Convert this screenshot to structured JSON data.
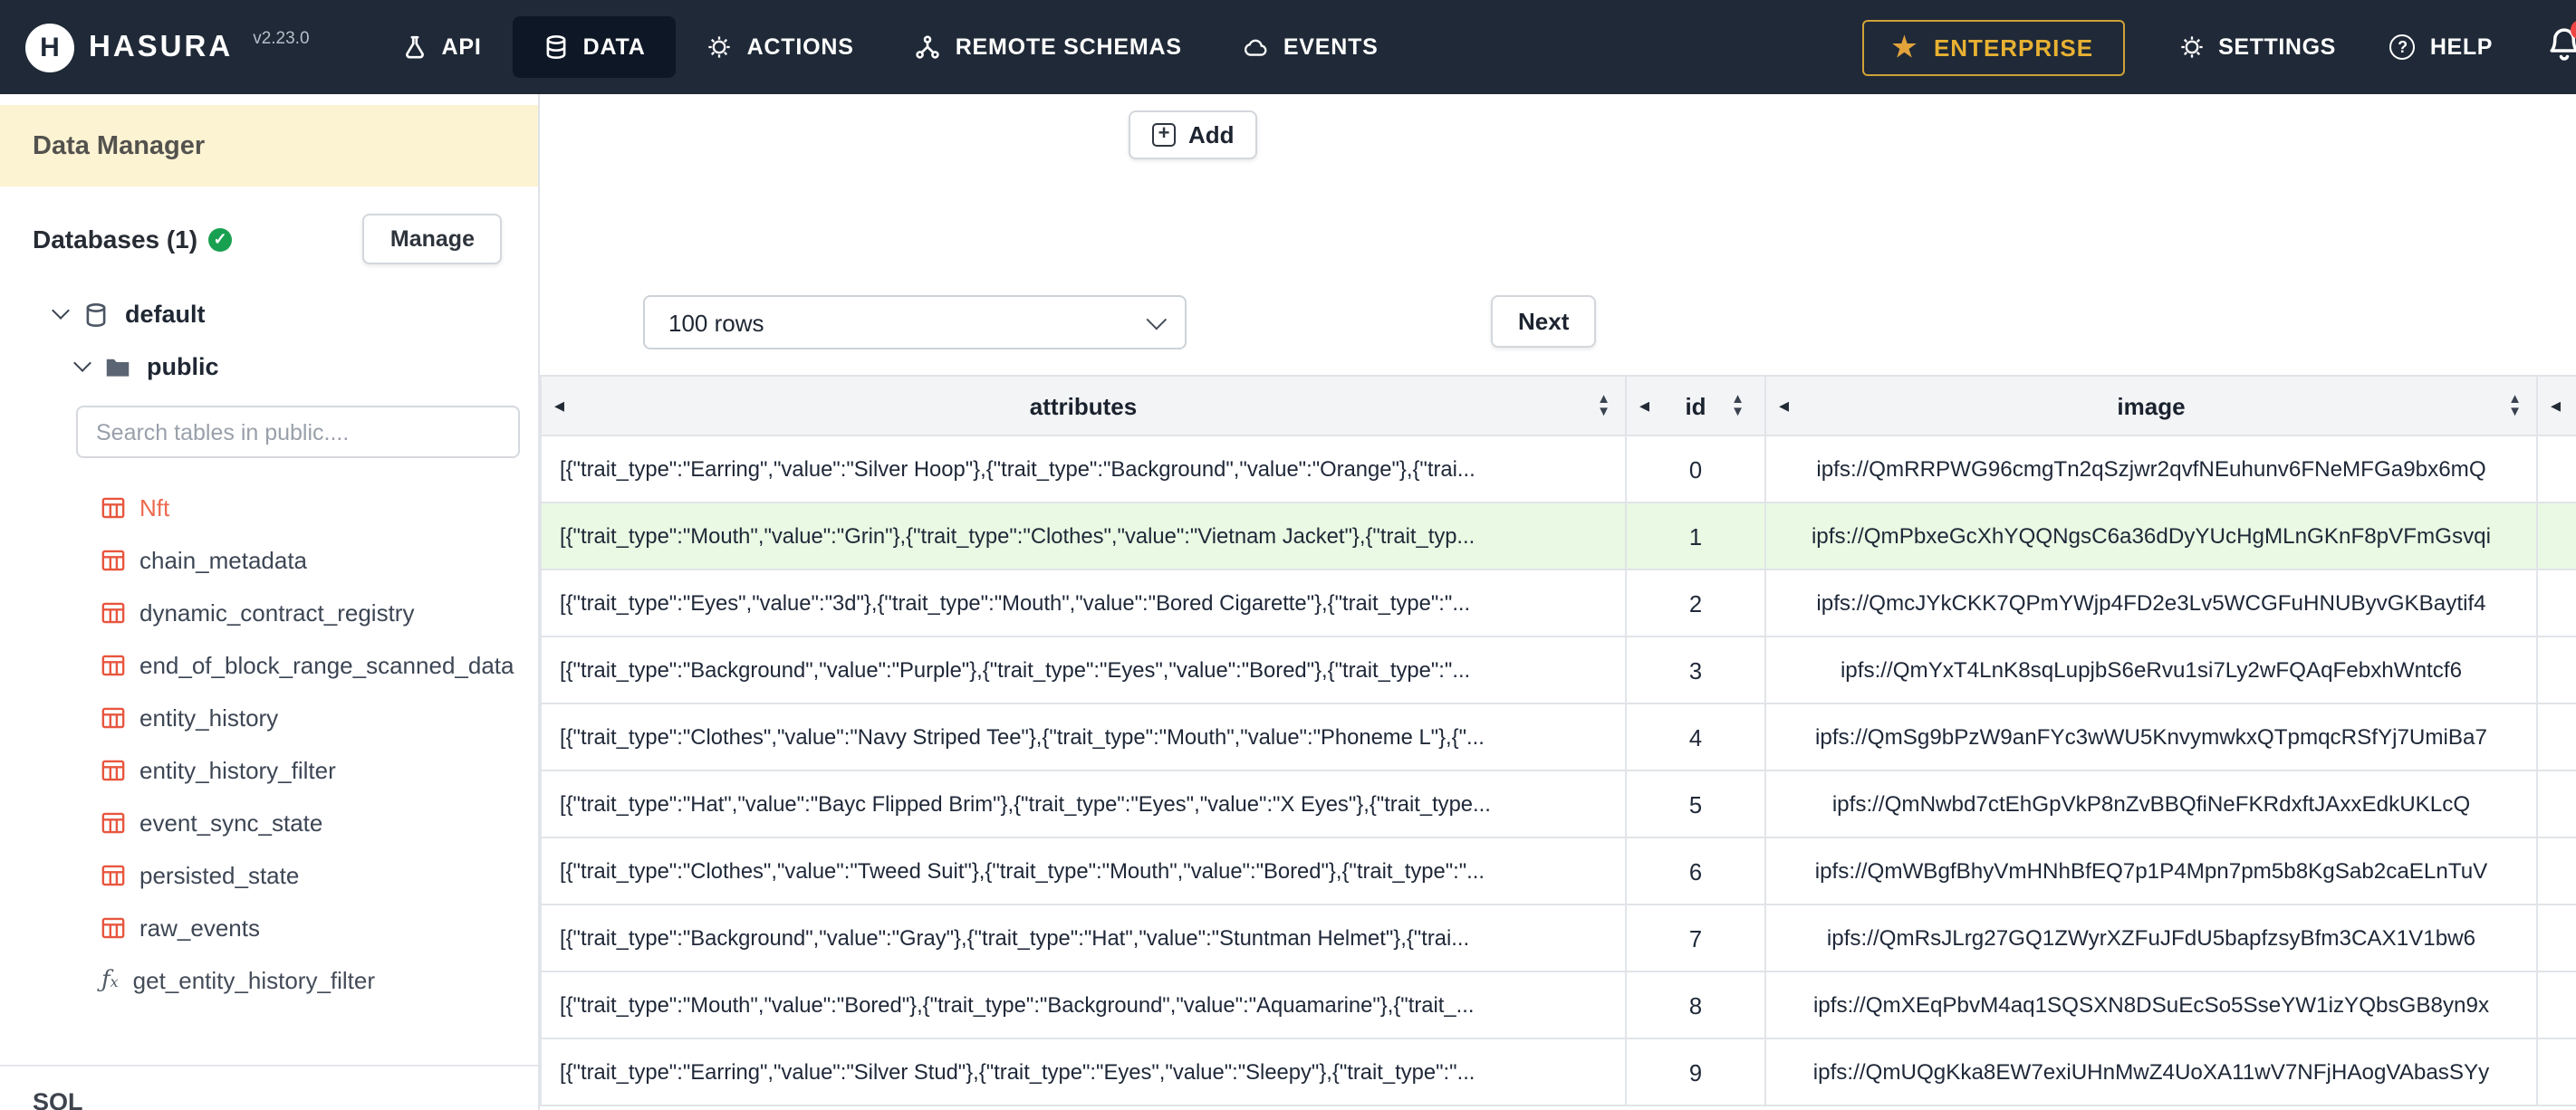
{
  "navbar": {
    "brand": "HASURA",
    "version": "v2.23.0",
    "items": [
      {
        "label": "API"
      },
      {
        "label": "DATA"
      },
      {
        "label": "ACTIONS"
      },
      {
        "label": "REMOTE SCHEMAS"
      },
      {
        "label": "EVENTS"
      }
    ],
    "enterprise": "ENTERPRISE",
    "settings": "SETTINGS",
    "help": "HELP"
  },
  "sidebar": {
    "title": "Data Manager",
    "databases_label": "Databases (1)",
    "manage": "Manage",
    "database": "default",
    "schema": "public",
    "search_placeholder": "Search tables in public....",
    "tables": [
      "Nft",
      "chain_metadata",
      "dynamic_contract_registry",
      "end_of_block_range_scanned_data",
      "entity_history",
      "entity_history_filter",
      "event_sync_state",
      "persisted_state",
      "raw_events"
    ],
    "function": "get_entity_history_filter",
    "sql_label": "SQL"
  },
  "main": {
    "add": "Add",
    "rows_select": "100 rows",
    "next": "Next",
    "table": {
      "columns": [
        "attributes",
        "id",
        "image"
      ],
      "rows": [
        {
          "attributes": "[{\"trait_type\":\"Earring\",\"value\":\"Silver Hoop\"},{\"trait_type\":\"Background\",\"value\":\"Orange\"},{\"trai...",
          "id": 0,
          "image": "ipfs://QmRRPWG96cmgTn2qSzjwr2qvfNEuhunv6FNeMFGa9bx6mQ"
        },
        {
          "attributes": "[{\"trait_type\":\"Mouth\",\"value\":\"Grin\"},{\"trait_type\":\"Clothes\",\"value\":\"Vietnam Jacket\"},{\"trait_typ...",
          "id": 1,
          "image": "ipfs://QmPbxeGcXhYQQNgsC6a36dDyYUcHgMLnGKnF8pVFmGsvqi"
        },
        {
          "attributes": "[{\"trait_type\":\"Eyes\",\"value\":\"3d\"},{\"trait_type\":\"Mouth\",\"value\":\"Bored Cigarette\"},{\"trait_type\":\"...",
          "id": 2,
          "image": "ipfs://QmcJYkCKK7QPmYWjp4FD2e3Lv5WCGFuHNUByvGKBaytif4"
        },
        {
          "attributes": "[{\"trait_type\":\"Background\",\"value\":\"Purple\"},{\"trait_type\":\"Eyes\",\"value\":\"Bored\"},{\"trait_type\":\"...",
          "id": 3,
          "image": "ipfs://QmYxT4LnK8sqLupjbS6eRvu1si7Ly2wFQAqFebxhWntcf6"
        },
        {
          "attributes": "[{\"trait_type\":\"Clothes\",\"value\":\"Navy Striped Tee\"},{\"trait_type\":\"Mouth\",\"value\":\"Phoneme L\"},{\"...",
          "id": 4,
          "image": "ipfs://QmSg9bPzW9anFYc3wWU5KnvymwkxQTpmqcRSfYj7UmiBa7"
        },
        {
          "attributes": "[{\"trait_type\":\"Hat\",\"value\":\"Bayc Flipped Brim\"},{\"trait_type\":\"Eyes\",\"value\":\"X Eyes\"},{\"trait_type...",
          "id": 5,
          "image": "ipfs://QmNwbd7ctEhGpVkP8nZvBBQfiNeFKRdxftJAxxEdkUKLcQ"
        },
        {
          "attributes": "[{\"trait_type\":\"Clothes\",\"value\":\"Tweed Suit\"},{\"trait_type\":\"Mouth\",\"value\":\"Bored\"},{\"trait_type\":\"...",
          "id": 6,
          "image": "ipfs://QmWBgfBhyVmHNhBfEQ7p1P4Mpn7pm5b8KgSab2caELnTuV"
        },
        {
          "attributes": "[{\"trait_type\":\"Background\",\"value\":\"Gray\"},{\"trait_type\":\"Hat\",\"value\":\"Stuntman Helmet\"},{\"trai...",
          "id": 7,
          "image": "ipfs://QmRsJLrg27GQ1ZWyrXZFuJFdU5bapfzsyBfm3CAX1V1bw6"
        },
        {
          "attributes": "[{\"trait_type\":\"Mouth\",\"value\":\"Bored\"},{\"trait_type\":\"Background\",\"value\":\"Aquamarine\"},{\"trait_...",
          "id": 8,
          "image": "ipfs://QmXEqPbvM4aq1SQSXN8DSuEcSo5SseYW1izYQbsGB8yn9x"
        },
        {
          "attributes": "[{\"trait_type\":\"Earring\",\"value\":\"Silver Stud\"},{\"trait_type\":\"Eyes\",\"value\":\"Sleepy\"},{\"trait_type\":\"...",
          "id": 9,
          "image": "ipfs://QmUQgKka8EW7exiUHnMwZ4UoXA11wV7NFjHAogVAbasSYy"
        }
      ]
    }
  },
  "colors": {
    "navbar_bg": "#1f2937",
    "enterprise_gold": "#e8b132",
    "table_accent_red": "#e8563f",
    "highlight_row_green": "#e9f9e3",
    "sidebar_band_cream": "#fcf3d3"
  }
}
